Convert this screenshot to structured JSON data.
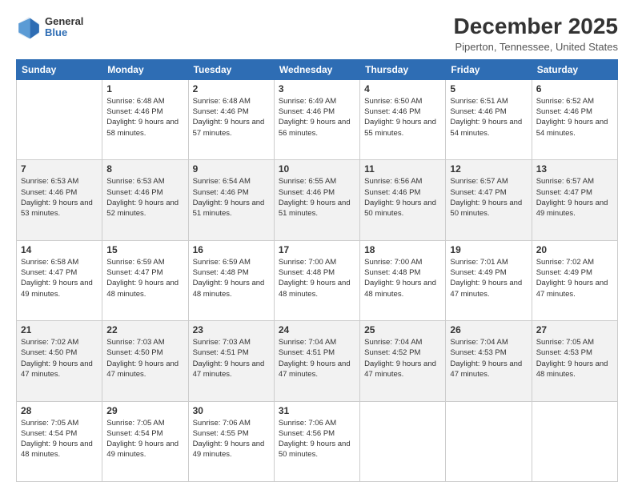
{
  "logo": {
    "general": "General",
    "blue": "Blue"
  },
  "header": {
    "title": "December 2025",
    "subtitle": "Piperton, Tennessee, United States"
  },
  "days_of_week": [
    "Sunday",
    "Monday",
    "Tuesday",
    "Wednesday",
    "Thursday",
    "Friday",
    "Saturday"
  ],
  "weeks": [
    [
      {
        "day": "",
        "sunrise": "",
        "sunset": "",
        "daylight": ""
      },
      {
        "day": "1",
        "sunrise": "Sunrise: 6:48 AM",
        "sunset": "Sunset: 4:46 PM",
        "daylight": "Daylight: 9 hours and 58 minutes."
      },
      {
        "day": "2",
        "sunrise": "Sunrise: 6:48 AM",
        "sunset": "Sunset: 4:46 PM",
        "daylight": "Daylight: 9 hours and 57 minutes."
      },
      {
        "day": "3",
        "sunrise": "Sunrise: 6:49 AM",
        "sunset": "Sunset: 4:46 PM",
        "daylight": "Daylight: 9 hours and 56 minutes."
      },
      {
        "day": "4",
        "sunrise": "Sunrise: 6:50 AM",
        "sunset": "Sunset: 4:46 PM",
        "daylight": "Daylight: 9 hours and 55 minutes."
      },
      {
        "day": "5",
        "sunrise": "Sunrise: 6:51 AM",
        "sunset": "Sunset: 4:46 PM",
        "daylight": "Daylight: 9 hours and 54 minutes."
      },
      {
        "day": "6",
        "sunrise": "Sunrise: 6:52 AM",
        "sunset": "Sunset: 4:46 PM",
        "daylight": "Daylight: 9 hours and 54 minutes."
      }
    ],
    [
      {
        "day": "7",
        "sunrise": "Sunrise: 6:53 AM",
        "sunset": "Sunset: 4:46 PM",
        "daylight": "Daylight: 9 hours and 53 minutes."
      },
      {
        "day": "8",
        "sunrise": "Sunrise: 6:53 AM",
        "sunset": "Sunset: 4:46 PM",
        "daylight": "Daylight: 9 hours and 52 minutes."
      },
      {
        "day": "9",
        "sunrise": "Sunrise: 6:54 AM",
        "sunset": "Sunset: 4:46 PM",
        "daylight": "Daylight: 9 hours and 51 minutes."
      },
      {
        "day": "10",
        "sunrise": "Sunrise: 6:55 AM",
        "sunset": "Sunset: 4:46 PM",
        "daylight": "Daylight: 9 hours and 51 minutes."
      },
      {
        "day": "11",
        "sunrise": "Sunrise: 6:56 AM",
        "sunset": "Sunset: 4:46 PM",
        "daylight": "Daylight: 9 hours and 50 minutes."
      },
      {
        "day": "12",
        "sunrise": "Sunrise: 6:57 AM",
        "sunset": "Sunset: 4:47 PM",
        "daylight": "Daylight: 9 hours and 50 minutes."
      },
      {
        "day": "13",
        "sunrise": "Sunrise: 6:57 AM",
        "sunset": "Sunset: 4:47 PM",
        "daylight": "Daylight: 9 hours and 49 minutes."
      }
    ],
    [
      {
        "day": "14",
        "sunrise": "Sunrise: 6:58 AM",
        "sunset": "Sunset: 4:47 PM",
        "daylight": "Daylight: 9 hours and 49 minutes."
      },
      {
        "day": "15",
        "sunrise": "Sunrise: 6:59 AM",
        "sunset": "Sunset: 4:47 PM",
        "daylight": "Daylight: 9 hours and 48 minutes."
      },
      {
        "day": "16",
        "sunrise": "Sunrise: 6:59 AM",
        "sunset": "Sunset: 4:48 PM",
        "daylight": "Daylight: 9 hours and 48 minutes."
      },
      {
        "day": "17",
        "sunrise": "Sunrise: 7:00 AM",
        "sunset": "Sunset: 4:48 PM",
        "daylight": "Daylight: 9 hours and 48 minutes."
      },
      {
        "day": "18",
        "sunrise": "Sunrise: 7:00 AM",
        "sunset": "Sunset: 4:48 PM",
        "daylight": "Daylight: 9 hours and 48 minutes."
      },
      {
        "day": "19",
        "sunrise": "Sunrise: 7:01 AM",
        "sunset": "Sunset: 4:49 PM",
        "daylight": "Daylight: 9 hours and 47 minutes."
      },
      {
        "day": "20",
        "sunrise": "Sunrise: 7:02 AM",
        "sunset": "Sunset: 4:49 PM",
        "daylight": "Daylight: 9 hours and 47 minutes."
      }
    ],
    [
      {
        "day": "21",
        "sunrise": "Sunrise: 7:02 AM",
        "sunset": "Sunset: 4:50 PM",
        "daylight": "Daylight: 9 hours and 47 minutes."
      },
      {
        "day": "22",
        "sunrise": "Sunrise: 7:03 AM",
        "sunset": "Sunset: 4:50 PM",
        "daylight": "Daylight: 9 hours and 47 minutes."
      },
      {
        "day": "23",
        "sunrise": "Sunrise: 7:03 AM",
        "sunset": "Sunset: 4:51 PM",
        "daylight": "Daylight: 9 hours and 47 minutes."
      },
      {
        "day": "24",
        "sunrise": "Sunrise: 7:04 AM",
        "sunset": "Sunset: 4:51 PM",
        "daylight": "Daylight: 9 hours and 47 minutes."
      },
      {
        "day": "25",
        "sunrise": "Sunrise: 7:04 AM",
        "sunset": "Sunset: 4:52 PM",
        "daylight": "Daylight: 9 hours and 47 minutes."
      },
      {
        "day": "26",
        "sunrise": "Sunrise: 7:04 AM",
        "sunset": "Sunset: 4:53 PM",
        "daylight": "Daylight: 9 hours and 47 minutes."
      },
      {
        "day": "27",
        "sunrise": "Sunrise: 7:05 AM",
        "sunset": "Sunset: 4:53 PM",
        "daylight": "Daylight: 9 hours and 48 minutes."
      }
    ],
    [
      {
        "day": "28",
        "sunrise": "Sunrise: 7:05 AM",
        "sunset": "Sunset: 4:54 PM",
        "daylight": "Daylight: 9 hours and 48 minutes."
      },
      {
        "day": "29",
        "sunrise": "Sunrise: 7:05 AM",
        "sunset": "Sunset: 4:54 PM",
        "daylight": "Daylight: 9 hours and 49 minutes."
      },
      {
        "day": "30",
        "sunrise": "Sunrise: 7:06 AM",
        "sunset": "Sunset: 4:55 PM",
        "daylight": "Daylight: 9 hours and 49 minutes."
      },
      {
        "day": "31",
        "sunrise": "Sunrise: 7:06 AM",
        "sunset": "Sunset: 4:56 PM",
        "daylight": "Daylight: 9 hours and 50 minutes."
      },
      {
        "day": "",
        "sunrise": "",
        "sunset": "",
        "daylight": ""
      },
      {
        "day": "",
        "sunrise": "",
        "sunset": "",
        "daylight": ""
      },
      {
        "day": "",
        "sunrise": "",
        "sunset": "",
        "daylight": ""
      }
    ]
  ]
}
